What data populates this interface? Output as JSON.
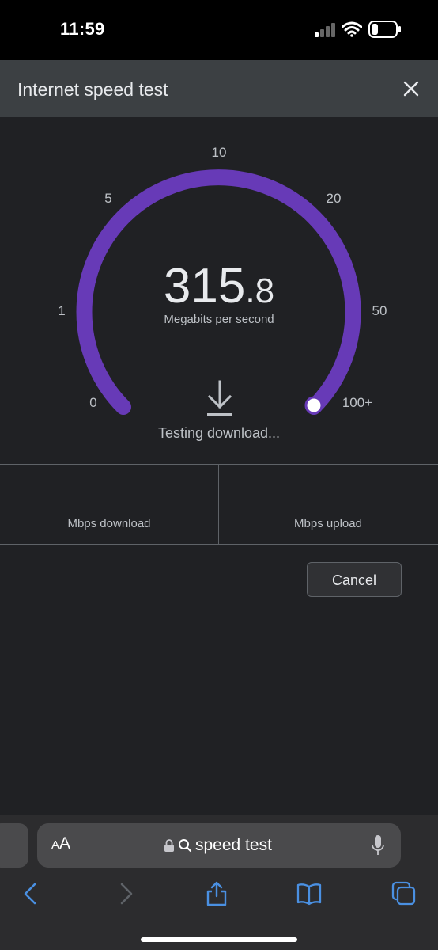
{
  "status_bar": {
    "time": "11:59"
  },
  "header": {
    "title": "Internet speed test"
  },
  "gauge": {
    "ticks": [
      "0",
      "1",
      "5",
      "10",
      "20",
      "50",
      "100+"
    ],
    "speed_integer": "315",
    "speed_decimal": ".8",
    "unit": "Megabits per second",
    "status": "Testing download...",
    "arc_color": "#673ab7"
  },
  "results": {
    "download_label": "Mbps download",
    "upload_label": "Mbps upload"
  },
  "actions": {
    "cancel_label": "Cancel"
  },
  "browser": {
    "text_size_small": "A",
    "text_size_big": "A",
    "address_text": "speed test"
  },
  "colors": {
    "accent": "#4a90e2",
    "background": "#202124",
    "header": "#3c4043"
  }
}
